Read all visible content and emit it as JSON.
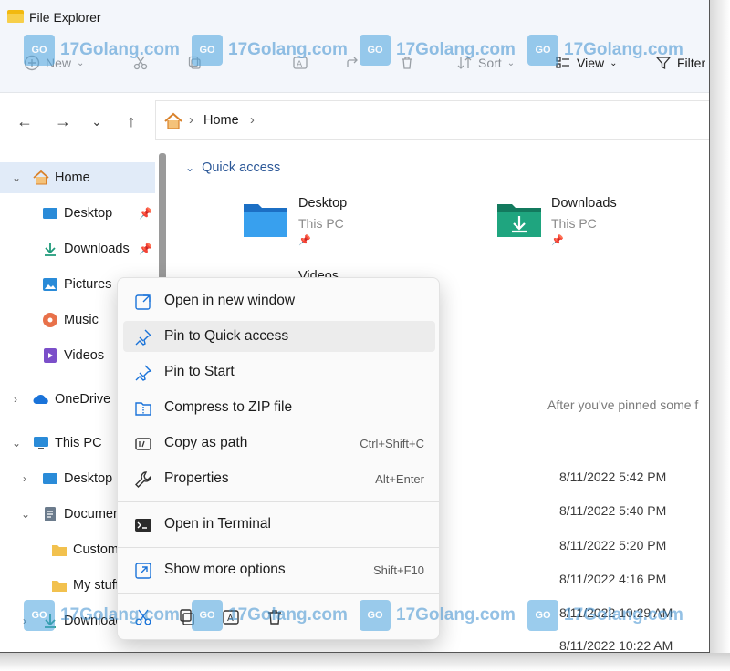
{
  "window": {
    "title": "File Explorer"
  },
  "toolbar": {
    "new_label": "New",
    "sort_label": "Sort",
    "view_label": "View",
    "filter_label": "Filter"
  },
  "address": {
    "crumb": "Home"
  },
  "sidebar": {
    "items": [
      {
        "label": "Home"
      },
      {
        "label": "Desktop"
      },
      {
        "label": "Downloads"
      },
      {
        "label": "Pictures"
      },
      {
        "label": "Music"
      },
      {
        "label": "Videos"
      },
      {
        "label": "OneDrive"
      },
      {
        "label": "This PC"
      },
      {
        "label": "Desktop"
      },
      {
        "label": "Documents"
      },
      {
        "label": "Custom"
      },
      {
        "label": "My stuff"
      },
      {
        "label": "Downloads"
      }
    ]
  },
  "content": {
    "quick_access_label": "Quick access",
    "folders": [
      {
        "name": "Desktop",
        "location": "This PC"
      },
      {
        "name": "Downloads",
        "location": "This PC"
      },
      {
        "name": "Videos",
        "location": ""
      }
    ],
    "hint": "After you've pinned some f",
    "dates": [
      "8/11/2022 5:42 PM",
      "8/11/2022 5:40 PM",
      "8/11/2022 5:20 PM",
      "8/11/2022 4:16 PM",
      "8/11/2022 10:29 AM",
      "8/11/2022 10:22 AM"
    ]
  },
  "context_menu": {
    "items": [
      {
        "label": "Open in new window",
        "shortcut": ""
      },
      {
        "label": "Pin to Quick access",
        "shortcut": ""
      },
      {
        "label": "Pin to Start",
        "shortcut": ""
      },
      {
        "label": "Compress to ZIP file",
        "shortcut": ""
      },
      {
        "label": "Copy as path",
        "shortcut": "Ctrl+Shift+C"
      },
      {
        "label": "Properties",
        "shortcut": "Alt+Enter"
      },
      {
        "label": "Open in Terminal",
        "shortcut": ""
      },
      {
        "label": "Show more options",
        "shortcut": "Shift+F10"
      }
    ]
  },
  "watermark": {
    "text": "17Golang.com"
  },
  "colors": {
    "accent": "#1a73d9",
    "selected": "#e1ebf8",
    "folder_blue": "#2a8bd8",
    "folder_teal": "#1f9a7a"
  }
}
